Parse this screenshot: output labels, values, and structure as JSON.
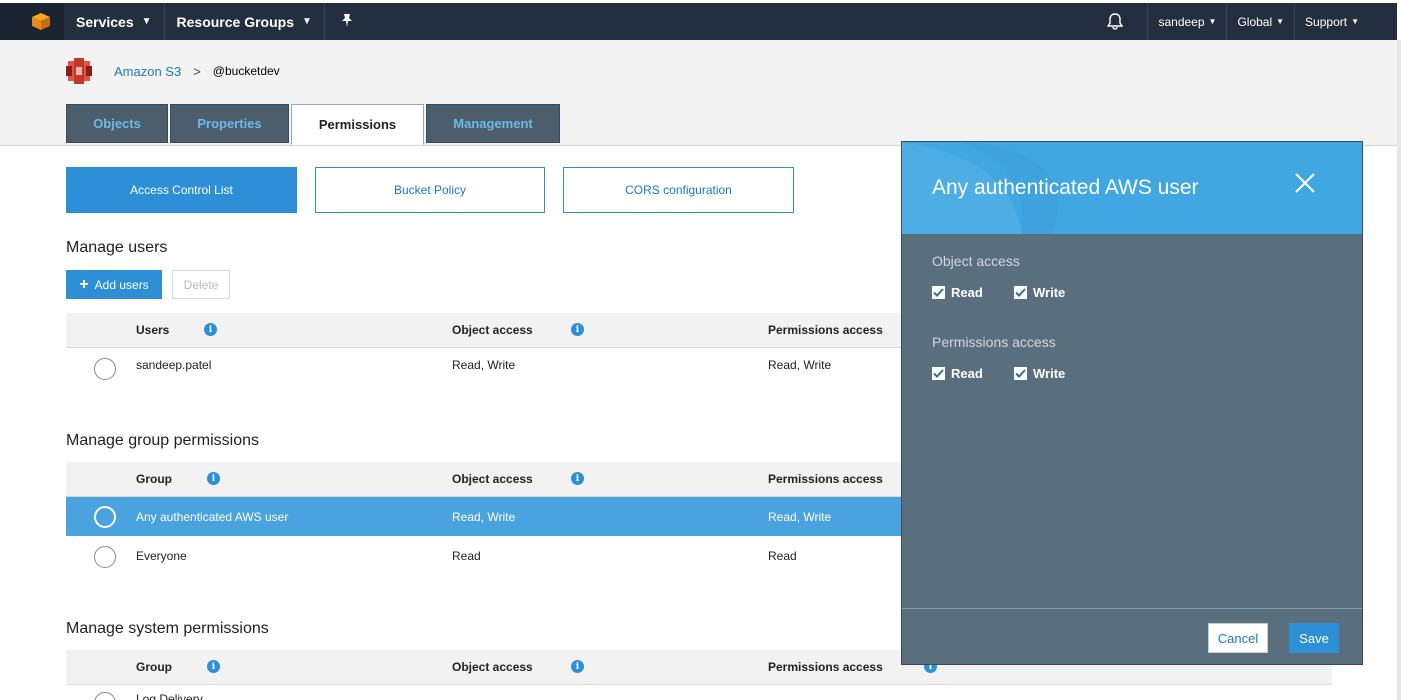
{
  "nav": {
    "services": "Services",
    "resource_groups": "Resource Groups",
    "user": "sandeep",
    "region": "Global",
    "support": "Support"
  },
  "breadcrumb": {
    "service": "Amazon S3",
    "bucket": "@bucketdev"
  },
  "tabs": [
    "Objects",
    "Properties",
    "Permissions",
    "Management"
  ],
  "subtabs": [
    "Access Control List",
    "Bucket Policy",
    "CORS configuration"
  ],
  "users_section": {
    "title": "Manage users",
    "add_button": "Add users",
    "delete_button": "Delete",
    "headers": {
      "name": "Users",
      "object": "Object access",
      "permissions": "Permissions access"
    },
    "rows": [
      {
        "name": "sandeep.patel",
        "object": "Read, Write",
        "permissions": "Read, Write"
      }
    ]
  },
  "group_section": {
    "title": "Manage group permissions",
    "headers": {
      "name": "Group",
      "object": "Object access",
      "permissions": "Permissions access"
    },
    "rows": [
      {
        "name": "Any authenticated AWS user",
        "object": "Read, Write",
        "permissions": "Read, Write"
      },
      {
        "name": "Everyone",
        "object": "Read",
        "permissions": "Read"
      }
    ]
  },
  "system_section": {
    "title": "Manage system permissions",
    "headers": {
      "name": "Group",
      "object": "Object access",
      "permissions": "Permissions access"
    },
    "rows": [
      {
        "name": "Log Delivery"
      }
    ]
  },
  "panel": {
    "title": "Any authenticated AWS user",
    "object_label": "Object access",
    "permissions_label": "Permissions access",
    "read": "Read",
    "write": "Write",
    "cancel": "Cancel",
    "save": "Save"
  },
  "colors": {
    "topbar": "#232f3e",
    "accent": "#2d8fd5",
    "selected_row": "#4aa3de",
    "panel_body": "#5a6f7e",
    "panel_head": "#41a7e0"
  }
}
